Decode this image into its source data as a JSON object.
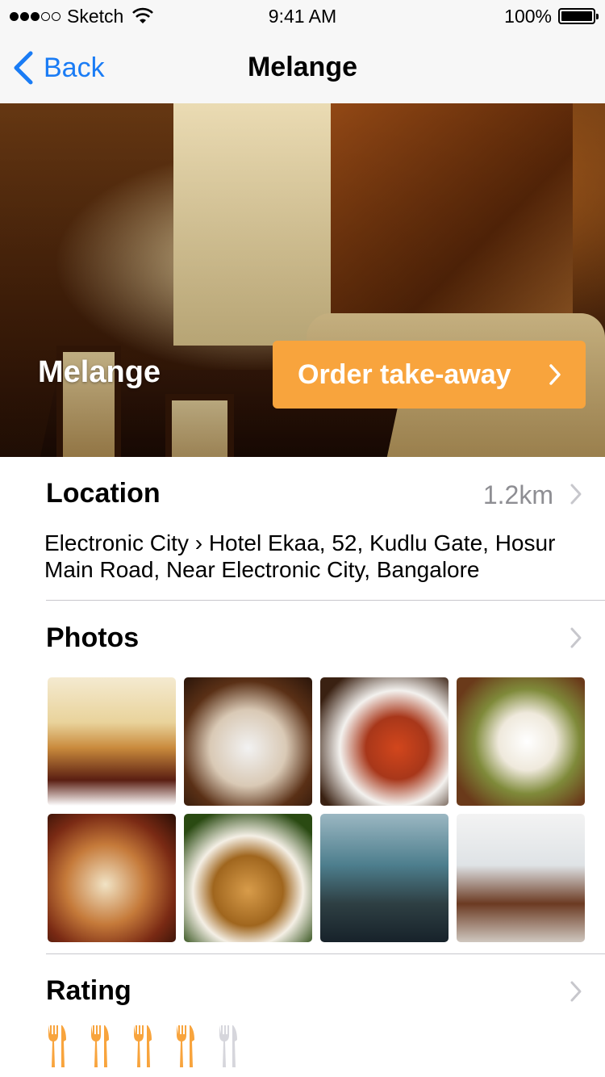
{
  "status_bar": {
    "carrier": "Sketch",
    "time": "9:41 AM",
    "battery": "100%",
    "signal_bars_filled": 3,
    "signal_bars_total": 5
  },
  "nav": {
    "back_label": "Back",
    "title": "Melange"
  },
  "hero": {
    "title": "Melange",
    "order_button": "Order take-away"
  },
  "location": {
    "title": "Location",
    "distance": "1.2km",
    "address": "Electronic City › Hotel Ekaa, 52, Kudlu Gate, Hosur Main Road, Near Electronic City, Bangalore"
  },
  "photos": {
    "title": "Photos",
    "count": 8
  },
  "rating": {
    "title": "Rating",
    "value": 4,
    "max": 5
  },
  "colors": {
    "accent_blue": "#1a7cf5",
    "accent_orange": "#f8a43d",
    "rating_inactive": "#d6d6dc",
    "secondary_text": "#8e8e93"
  }
}
